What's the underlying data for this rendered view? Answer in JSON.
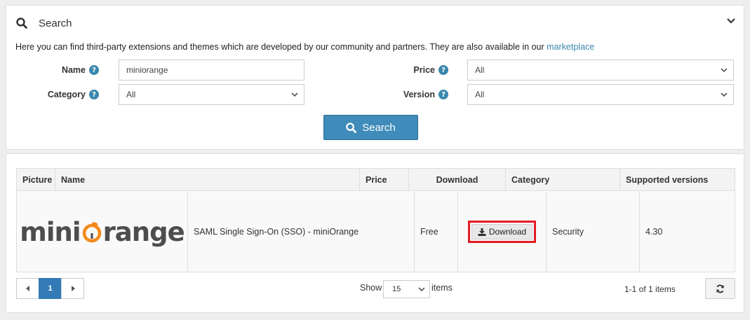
{
  "search": {
    "title": "Search",
    "intro_text": "Here you can find third-party extensions and themes which are developed by our community and partners. They are also available in our ",
    "intro_link": "marketplace",
    "fields": {
      "name_label": "Name",
      "name_value": "miniorange",
      "category_label": "Category",
      "category_value": "All",
      "price_label": "Price",
      "price_value": "All",
      "version_label": "Version",
      "version_value": "All"
    },
    "button_label": "Search"
  },
  "results": {
    "columns": [
      "Picture",
      "Name",
      "Price",
      "Download",
      "Category",
      "Supported versions"
    ],
    "rows": [
      {
        "logo_text_a": "mini",
        "logo_text_b": "range",
        "name": "SAML Single Sign-On (SSO) - miniOrange",
        "price": "Free",
        "download_label": "Download",
        "category": "Security",
        "versions": "4.30"
      }
    ],
    "pager": {
      "current_page": "1",
      "show_label": "Show",
      "page_size": "15",
      "items_label": "items",
      "count_text": "1-1 of 1 items"
    }
  },
  "colors": {
    "accent": "#3f8bba",
    "link": "#3a87ad",
    "highlight": "#e31b23",
    "brand_orange": "#f28a1a"
  }
}
